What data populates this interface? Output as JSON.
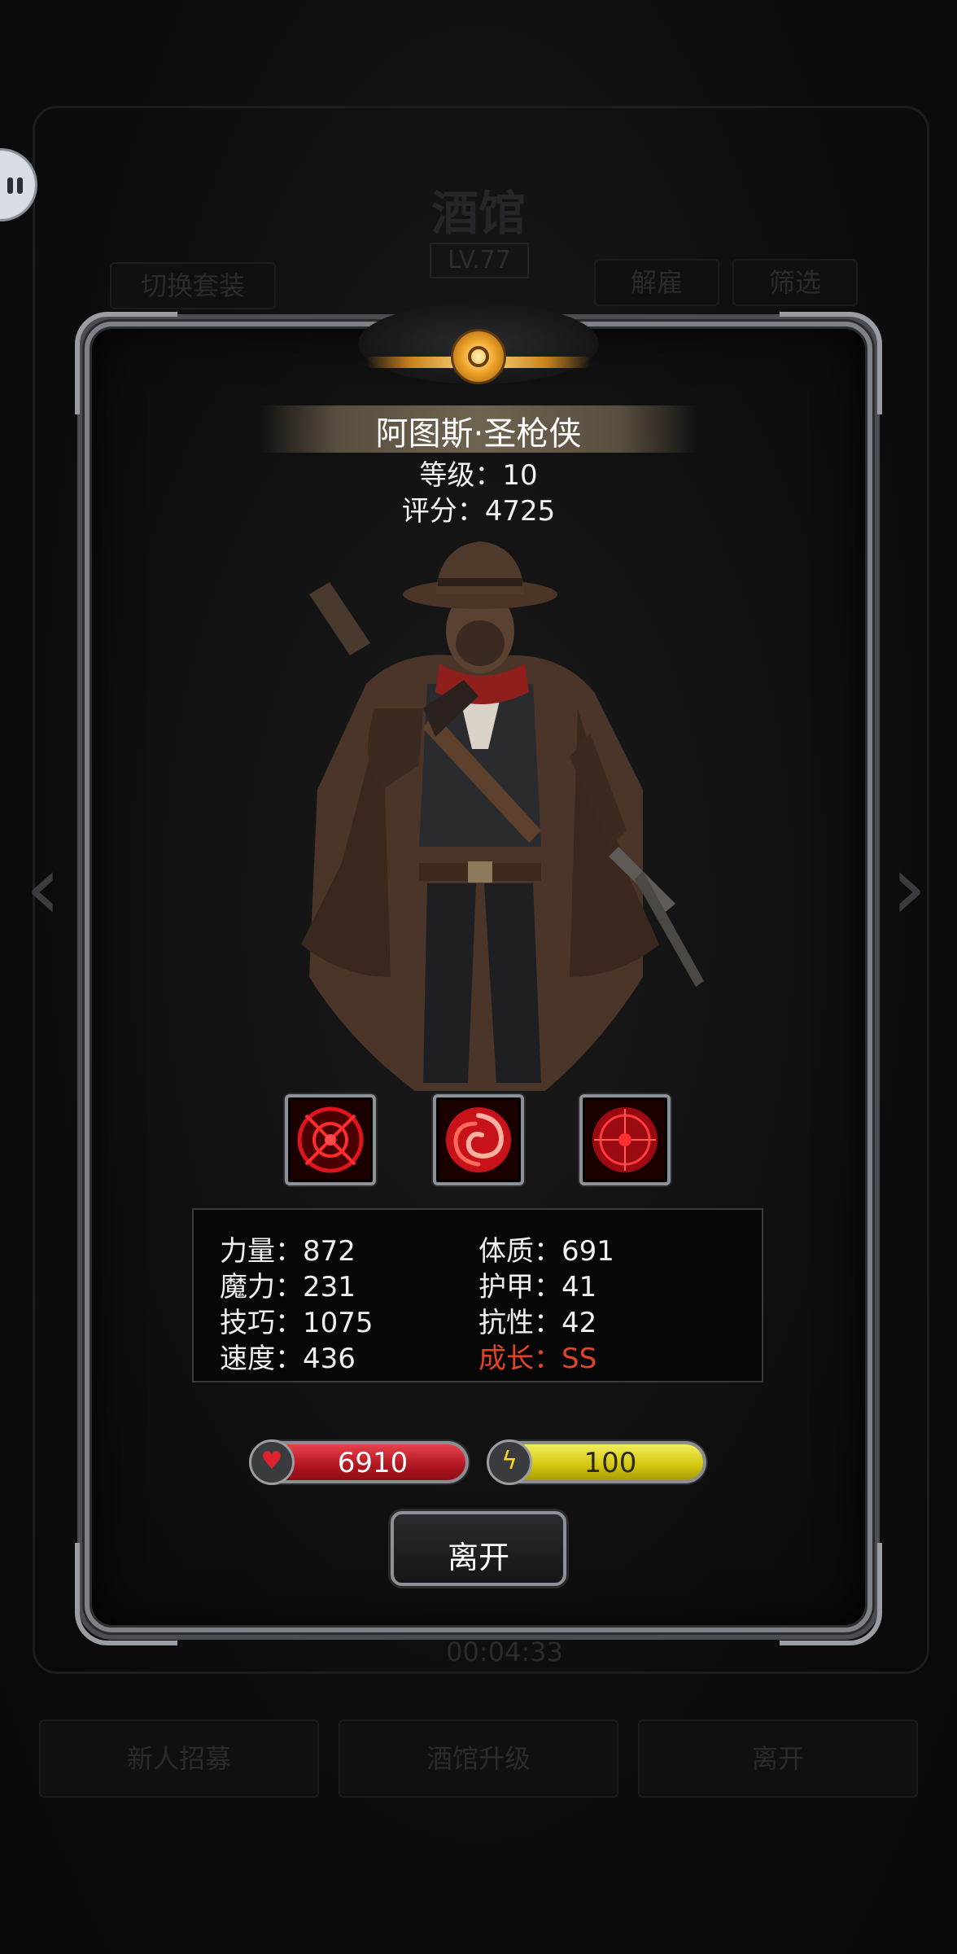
{
  "background": {
    "title": "酒馆",
    "level_badge": "LV.77",
    "buttons": {
      "switch_outfit": "切换套装",
      "dismiss": "解雇",
      "filter": "筛选",
      "recruit": "新人招募",
      "upgrade": "酒馆升级",
      "leave": "离开"
    },
    "timer": "00:04:33"
  },
  "hero": {
    "name": "阿图斯·圣枪侠",
    "level_text": "等级：10",
    "score_text": "评分：4725"
  },
  "skills": [
    {
      "icon": "crosshair-orb-icon",
      "color": "#d0121c"
    },
    {
      "icon": "swirl-vortex-icon",
      "color": "#e31b1b"
    },
    {
      "icon": "target-scope-icon",
      "color": "#c81018"
    }
  ],
  "stats": {
    "strength": "力量：872",
    "magic": "魔力：231",
    "skill": "技巧：1075",
    "speed": "速度：436",
    "constitution": "体质：691",
    "armor": "护甲：41",
    "resistance": "抗性：42",
    "growth": "成长：SS"
  },
  "bars": {
    "hp": "6910",
    "energy": "100"
  },
  "leave_button": "离开",
  "colors": {
    "hp_bar": "#c41a25",
    "energy_bar": "#dccd16",
    "growth_text": "#e0452a",
    "gold_accent": "#f0a62a"
  }
}
